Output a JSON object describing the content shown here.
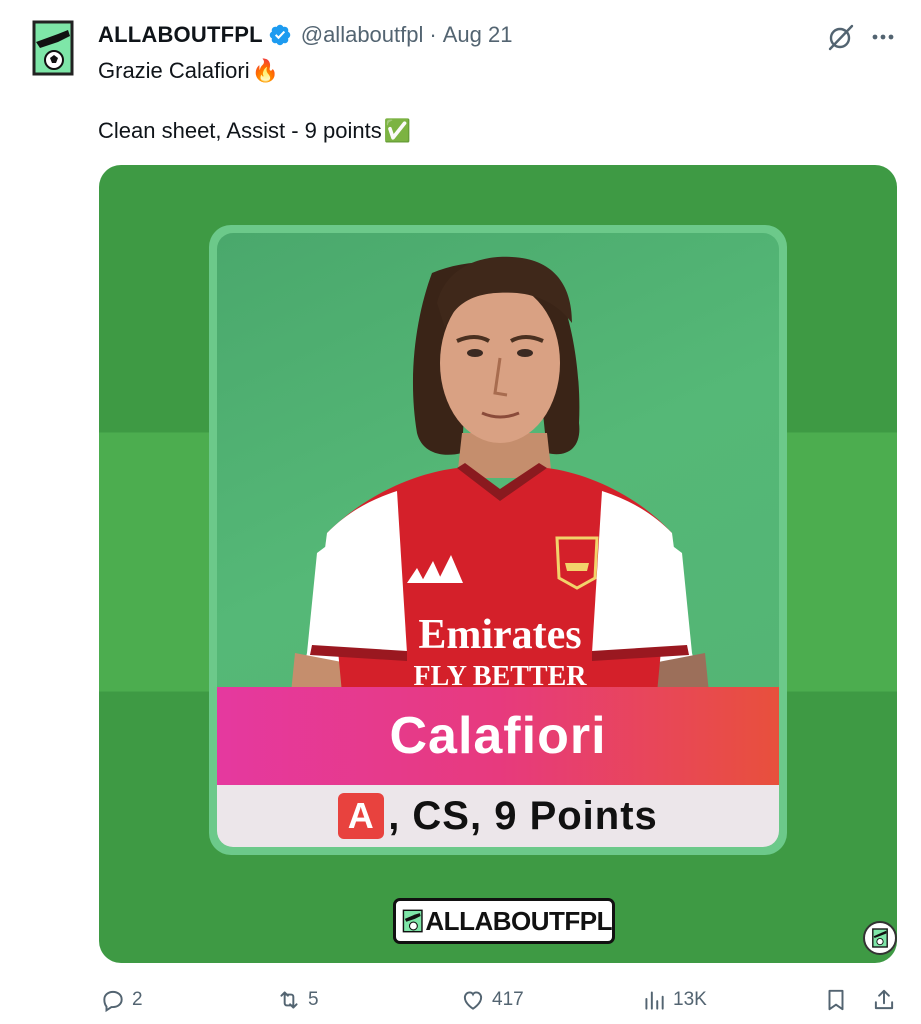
{
  "tweet": {
    "display_name": "ALLABOUTFPL",
    "handle": "@allaboutfpl",
    "separator": "·",
    "date": "Aug 21",
    "text_line1": "Grazie Calafiori",
    "text_line1_emoji": "🔥",
    "text_line2": "Clean sheet, Assist - 9 points",
    "text_line2_emoji": "✅"
  },
  "media": {
    "player_name": "Calafiori",
    "stats_badge": "A",
    "stats_text": ", CS, 9 Points",
    "shirt_sponsor_line1": "Emirates",
    "shirt_sponsor_line2": "FLY BETTER",
    "brand_text": "ALLABOUTFPL"
  },
  "actions": {
    "replies": "2",
    "reposts": "5",
    "likes": "417",
    "views": "13K"
  },
  "colors": {
    "verified": "#1d9bf0",
    "text_secondary": "#536471",
    "media_green": "#3e9a44",
    "banner_pink": "#e5399f",
    "banner_orange": "#e8503c",
    "shirt_red": "#d4202a"
  }
}
